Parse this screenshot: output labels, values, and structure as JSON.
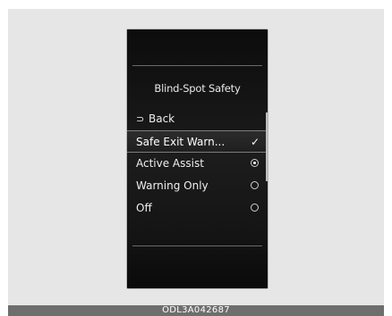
{
  "screen": {
    "title": "Blind-Spot Safety",
    "back_label": "Back",
    "back_icon": "⊃",
    "items": [
      {
        "label": "Safe Exit Warn...",
        "control": "check",
        "state": "checked"
      },
      {
        "label": "Active Assist",
        "control": "radio",
        "state": "selected"
      },
      {
        "label": "Warning Only",
        "control": "radio",
        "state": "unselected"
      },
      {
        "label": "Off",
        "control": "radio",
        "state": "unselected"
      }
    ],
    "check_glyph": "✓"
  },
  "caption": "ODL3A042687",
  "colors": {
    "frame_background": "#e6e6e6",
    "screen_background": "#151515",
    "text": "#efefef",
    "caption_bar": "#6e6e6e"
  }
}
